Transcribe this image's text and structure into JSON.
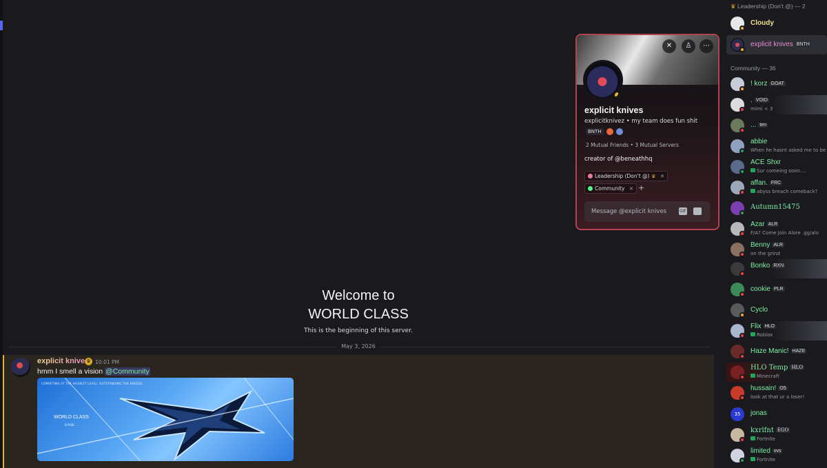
{
  "chat": {
    "welcome_line1": "Welcome to",
    "welcome_line2": "WORLD CLASS",
    "welcome_sub": "This is the beginning of this server.",
    "date_divider": "May 3, 2026",
    "message": {
      "author": "explicit knives",
      "time": "10:01 PM",
      "text": "hmm I smell a vision",
      "mention": "@Community",
      "image_brand": "WORLD CLASS",
      "image_top_text": "COMPETING AT THE HIGHEST LEVEL. OUTSTANDING THE BREEDS.",
      "image_small_text": "B PUBL"
    }
  },
  "profile": {
    "display_name": "explicit knives",
    "username": "explicitknivez",
    "separator": "•",
    "pronouns": "my team does fun shit",
    "tag": "BNTH",
    "mutual_friends": "2 Mutual Friends",
    "mutual_servers": "3 Mutual Servers",
    "bio": "creator of @beneathhq",
    "roles": [
      {
        "name": "Leadership (Don't @)",
        "color": "#e87b9b"
      },
      {
        "name": "Community",
        "color": "#57f287"
      }
    ],
    "add_role": "+",
    "message_placeholder": "Message @explicit knives",
    "status_color": "#f0b132"
  },
  "members": {
    "groups": [
      {
        "header": "Leadership (Don't @) — 2"
      },
      {
        "header": "Community — 36"
      }
    ],
    "leadership": [
      {
        "name": "Cloudy",
        "tag": "",
        "sub": "",
        "color": "#f0e08a"
      },
      {
        "name": "explicit knives",
        "tag": "BNTH",
        "sub": "",
        "color": "#e98bd0"
      }
    ],
    "community": [
      {
        "name": "! korz",
        "tag": "GOAT",
        "sub": "",
        "color": "#7ef0a4",
        "status": "#f0b132"
      },
      {
        "name": ".",
        "tag": "VOID",
        "sub": "mimi < 3",
        "color": "#7ef0a4",
        "status": "#f23f43"
      },
      {
        "name": "...",
        "tag": "ten",
        "sub": "",
        "color": "#7ef0a4",
        "status": "#f23f43"
      },
      {
        "name": "abbie",
        "tag": "",
        "sub": "When he hasnt asked me to be h",
        "color": "#7ef0a4",
        "status": "#23a559"
      },
      {
        "name": "ACE Shxr",
        "tag": "",
        "sub": "Sur comeing soon....",
        "color": "#7ef0a4",
        "status": "#23a559"
      },
      {
        "name": "affan.",
        "tag": "FRC",
        "sub": "abyss breach comeback?",
        "color": "#7ef0a4",
        "status": "#f23f43"
      },
      {
        "name": "Autumn15475",
        "tag": "",
        "sub": "",
        "color": "#7ef0a4",
        "status": "#23a559"
      },
      {
        "name": "Azar",
        "tag": "ALR",
        "sub": "F/A? Come Join Alore .gg/alo",
        "color": "#7ef0a4",
        "status": "#f23f43"
      },
      {
        "name": "Benny",
        "tag": "ALR",
        "sub": "on the grind",
        "color": "#7ef0a4",
        "status": "#f23f43"
      },
      {
        "name": "Bonko",
        "tag": "RXN",
        "sub": "",
        "color": "#7ef0a4",
        "status": "#f23f43"
      },
      {
        "name": "cookie",
        "tag": "PLR",
        "sub": "",
        "color": "#7ef0a4",
        "status": "#f23f43"
      },
      {
        "name": "Cyclo",
        "tag": "",
        "sub": "",
        "color": "#7ef0a4",
        "status": "#f0b132"
      },
      {
        "name": "Flix",
        "tag": "HLO",
        "sub": "Roblox",
        "color": "#7ef0a4",
        "status": "#f23f43"
      },
      {
        "name": "Haze Manic!",
        "tag": "HAZE",
        "sub": "",
        "color": "#7ef0a4",
        "status": "#f23f43"
      },
      {
        "name": "HLO Temp",
        "tag": "HLO",
        "sub": "Minecraft",
        "color": "#7ef0a4",
        "status": "#f23f43"
      },
      {
        "name": "hussain!",
        "tag": "O5",
        "sub": "look at that ur a loser!",
        "color": "#7ef0a4",
        "status": "#f23f43"
      },
      {
        "name": "jonas",
        "tag": "",
        "sub": "",
        "color": "#7ef0a4",
        "status": "#f23f43"
      },
      {
        "name": "kxrlfnt",
        "tag": "EGO",
        "sub": "Fortnite",
        "color": "#7ef0a4",
        "status": "#f23f43"
      },
      {
        "name": "limited",
        "tag": "vvs",
        "sub": "Fortnite",
        "color": "#7ef0a4",
        "status": "#23a559"
      }
    ]
  }
}
